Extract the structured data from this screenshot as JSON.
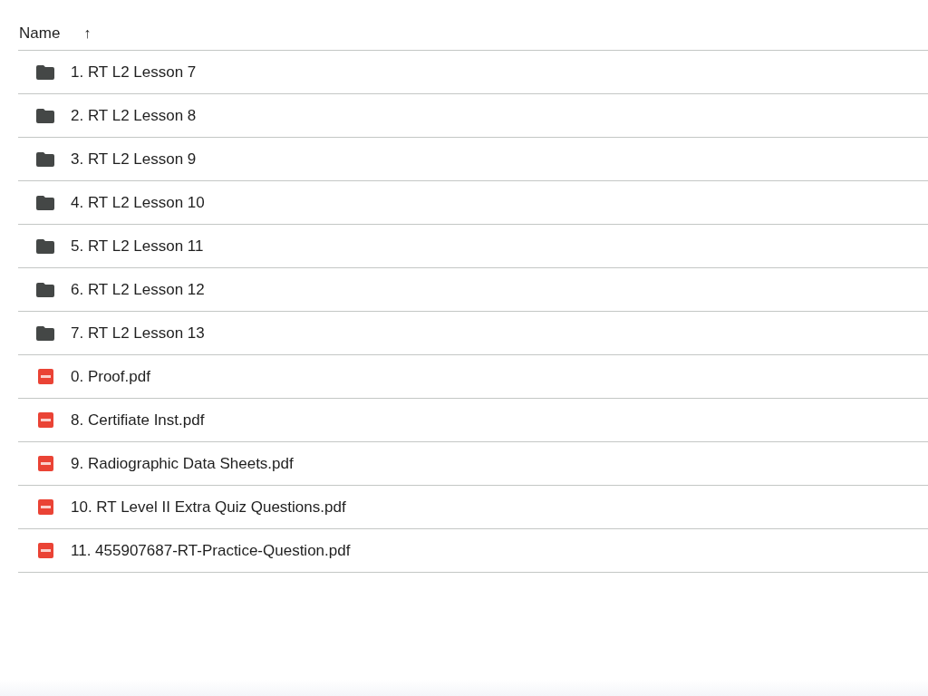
{
  "header": {
    "label": "Name",
    "sort_icon": "↑"
  },
  "files": [
    {
      "kind": "folder",
      "name": "1. RT L2 Lesson 7"
    },
    {
      "kind": "folder",
      "name": "2. RT L2 Lesson 8"
    },
    {
      "kind": "folder",
      "name": "3. RT L2 Lesson 9"
    },
    {
      "kind": "folder",
      "name": "4. RT L2 Lesson 10"
    },
    {
      "kind": "folder",
      "name": "5. RT L2 Lesson 11"
    },
    {
      "kind": "folder",
      "name": "6. RT L2 Lesson 12"
    },
    {
      "kind": "folder",
      "name": "7. RT L2 Lesson 13"
    },
    {
      "kind": "pdf",
      "name": "0. Proof.pdf"
    },
    {
      "kind": "pdf",
      "name": "8. Certifiate Inst.pdf"
    },
    {
      "kind": "pdf",
      "name": "9. Radiographic Data Sheets.pdf"
    },
    {
      "kind": "pdf",
      "name": "10. RT Level II Extra Quiz Questions.pdf"
    },
    {
      "kind": "pdf",
      "name": "11. 455907687-RT-Practice-Question.pdf"
    }
  ]
}
